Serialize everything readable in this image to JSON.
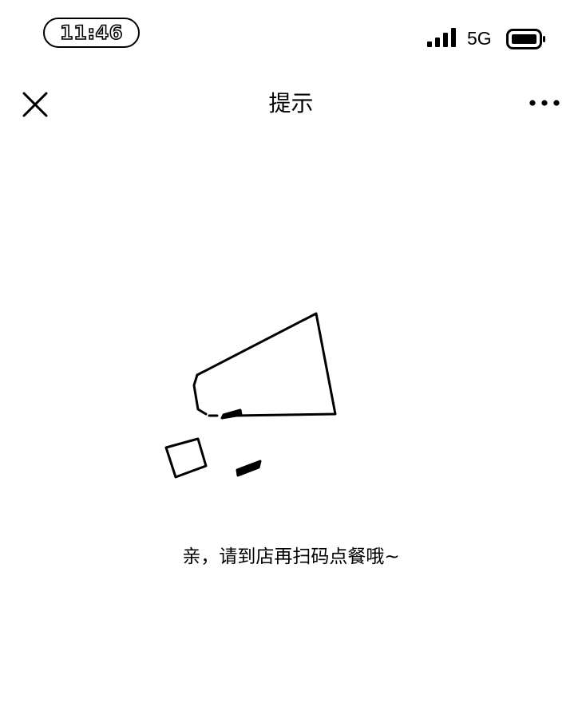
{
  "status_bar": {
    "time": "11:46",
    "network": "5G",
    "icons": [
      "signal-icon",
      "battery-icon"
    ]
  },
  "nav": {
    "title": "提示",
    "icons": [
      "close-icon",
      "more-icon"
    ]
  },
  "main": {
    "illustration_icon": "megaphone-icon",
    "message": "亲，请到店再扫码点餐哦~"
  }
}
